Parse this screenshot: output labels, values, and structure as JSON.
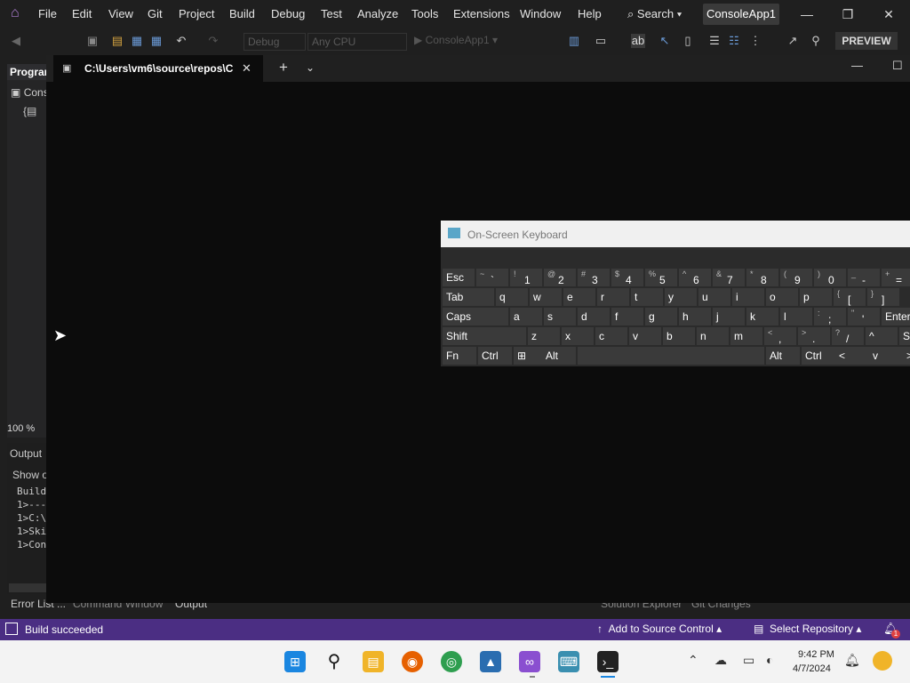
{
  "vs": {
    "menu": [
      "File",
      "Edit",
      "View",
      "Git",
      "Project",
      "Build",
      "Debug",
      "Test",
      "Analyze",
      "Tools",
      "Extensions",
      "Window",
      "Help"
    ],
    "search_label": "Search",
    "project_name": "ConsoleApp1",
    "toolbar": {
      "config_combo": "Debug",
      "platform_combo": "Any CPU",
      "start_label": "ConsoleApp1",
      "preview_label": "PREVIEW"
    },
    "program_tab": "Program",
    "program_tree_item": "Conso",
    "zoom": "100 %",
    "output": {
      "title": "Output",
      "show_output_from": "Show o",
      "lines": [
        "Build",
        "1>---",
        "1>C:\\",
        "1>Ski",
        "1>Con"
      ]
    },
    "bottom_tabs": [
      "Error List ...",
      "Command Window",
      "Output",
      "Solution Explorer",
      "Git Changes"
    ],
    "status": {
      "build": "Build succeeded",
      "source_control": "Add to Source Control",
      "repository": "Select Repository",
      "notifications": "1"
    }
  },
  "terminal": {
    "tab_title": "C:\\Users\\vm6\\source\\repos\\C"
  },
  "osk": {
    "title": "On-Screen Keyboard",
    "rows": [
      [
        {
          "l": "Esc"
        },
        {
          "s": "~",
          "m": "`"
        },
        {
          "s": "!",
          "m": "1"
        },
        {
          "s": "@",
          "m": "2"
        },
        {
          "s": "#",
          "m": "3"
        },
        {
          "s": "$",
          "m": "4"
        },
        {
          "s": "%",
          "m": "5"
        },
        {
          "s": "^",
          "m": "6"
        },
        {
          "s": "&",
          "m": "7"
        },
        {
          "s": "*",
          "m": "8"
        },
        {
          "s": "(",
          "m": "9"
        },
        {
          "s": ")",
          "m": "0"
        },
        {
          "s": "_",
          "m": "-"
        },
        {
          "s": "+",
          "m": "="
        }
      ],
      [
        {
          "l": "Tab"
        },
        {
          "l": "q"
        },
        {
          "l": "w"
        },
        {
          "l": "e"
        },
        {
          "l": "r"
        },
        {
          "l": "t"
        },
        {
          "l": "y"
        },
        {
          "l": "u"
        },
        {
          "l": "i"
        },
        {
          "l": "o"
        },
        {
          "l": "p"
        },
        {
          "s": "{",
          "m": "["
        },
        {
          "s": "}",
          "m": "]"
        }
      ],
      [
        {
          "l": "Caps"
        },
        {
          "l": "a"
        },
        {
          "l": "s"
        },
        {
          "l": "d"
        },
        {
          "l": "f"
        },
        {
          "l": "g"
        },
        {
          "l": "h"
        },
        {
          "l": "j"
        },
        {
          "l": "k"
        },
        {
          "l": "l"
        },
        {
          "s": ":",
          "m": ";"
        },
        {
          "s": "\"",
          "m": "'"
        },
        {
          "l": "Enter"
        }
      ],
      [
        {
          "l": "Shift"
        },
        {
          "l": "z"
        },
        {
          "l": "x"
        },
        {
          "l": "c"
        },
        {
          "l": "v"
        },
        {
          "l": "b"
        },
        {
          "l": "n"
        },
        {
          "l": "m"
        },
        {
          "s": "<",
          "m": ","
        },
        {
          "s": ">",
          "m": "."
        },
        {
          "s": "?",
          "m": "/"
        },
        {
          "l": "^"
        },
        {
          "l": "Sh"
        }
      ],
      [
        {
          "l": "Fn"
        },
        {
          "l": "Ctrl"
        },
        {
          "l": "⊞"
        },
        {
          "l": "Alt"
        },
        {
          "l": ""
        },
        {
          "l": "Alt"
        },
        {
          "l": "Ctrl"
        },
        {
          "l": "<"
        },
        {
          "l": "v"
        },
        {
          "l": ">"
        }
      ]
    ]
  },
  "taskbar": {
    "time": "9:42 PM",
    "date": "4/7/2024",
    "apps": [
      "start-icon",
      "search-icon",
      "file-explorer-icon",
      "firefox-icon",
      "chrome-icon",
      "photos-icon",
      "visual-studio-icon",
      "on-screen-keyboard-icon",
      "terminal-icon"
    ]
  },
  "colors": {
    "status_bar": "#4b2e83",
    "terminal_bg": "#0c0c0c",
    "vs_bg": "#1f1f1f"
  }
}
